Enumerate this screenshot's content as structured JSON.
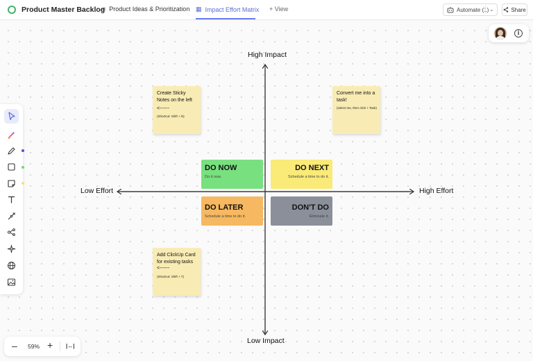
{
  "app": {
    "title": "Product Master Backlog"
  },
  "tabs": [
    {
      "label": "Product Ideas & Prioritization",
      "icon": "list-icon"
    },
    {
      "label": "Impact Effort Matrix",
      "icon": "whiteboard-icon",
      "active": true
    },
    {
      "label": "+ View",
      "icon": "plus-icon"
    }
  ],
  "header_actions": {
    "automate_label": "Automate (1)",
    "share_label": "Share"
  },
  "toolbar": {
    "tools": [
      "select-tool",
      "ai-brush-tool",
      "pen-tool",
      "shape-tool",
      "sticky-note-tool",
      "text-tool",
      "connector-tool",
      "mind-map-tool",
      "magic-tool",
      "embed-tool",
      "image-tool"
    ],
    "dot_colors": [
      "#5b4bd6",
      "#7ed07a",
      "#f2e27a"
    ]
  },
  "zoom": {
    "level": "59%"
  },
  "matrix": {
    "axes": {
      "top": "High Impact",
      "bottom": "Low Impact",
      "left": "Low Effort",
      "right": "High Effort"
    },
    "quadrants": [
      {
        "title": "DO NOW",
        "subtitle": "Do it now.",
        "color": "#78e07f"
      },
      {
        "title": "DO NEXT",
        "subtitle": "Schedule a time to do it.",
        "color": "#faea77"
      },
      {
        "title": "DO LATER",
        "subtitle": "Schedule a time to do it.",
        "color": "#f6b860"
      },
      {
        "title": "DON'T DO",
        "subtitle": "Eliminate it.",
        "color": "#8a8f9a"
      }
    ]
  },
  "stickies": [
    {
      "heading": "Create Sticky Notes on the left",
      "arrow": "<------",
      "shortcut": "(Shortcut: Shift + N)"
    },
    {
      "heading": "Convert me into a task!",
      "arrow": "",
      "shortcut": "(select me, then click + Task)"
    },
    {
      "heading": "Add ClickUp Card for existing tasks",
      "arrow": "<------",
      "shortcut": "(Shortcut: Shift + T)"
    }
  ]
}
